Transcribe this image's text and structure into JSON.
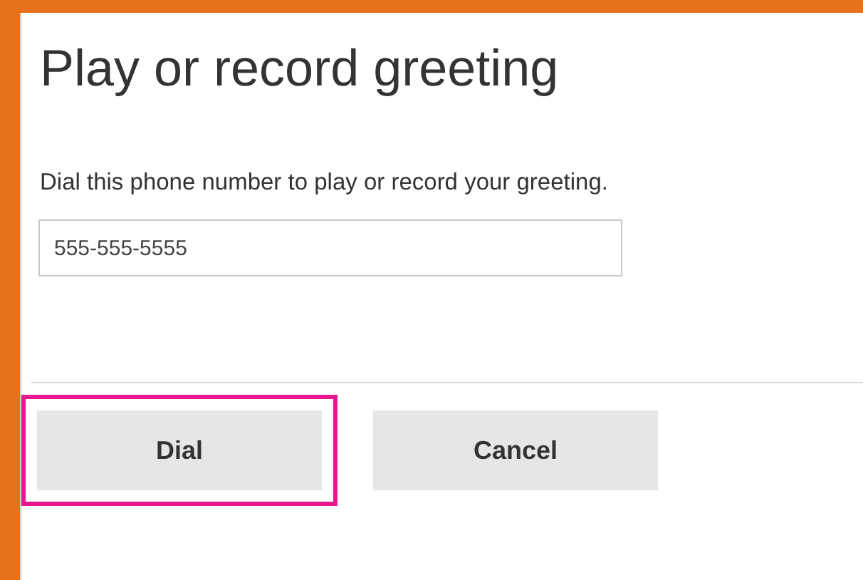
{
  "dialog": {
    "title": "Play or record greeting",
    "description": "Dial this phone number to play or record your greeting.",
    "phone_field": {
      "value": "555-555-5555"
    },
    "buttons": [
      {
        "label": "Dial",
        "highlighted": true
      },
      {
        "label": "Cancel",
        "highlighted": false
      }
    ]
  }
}
